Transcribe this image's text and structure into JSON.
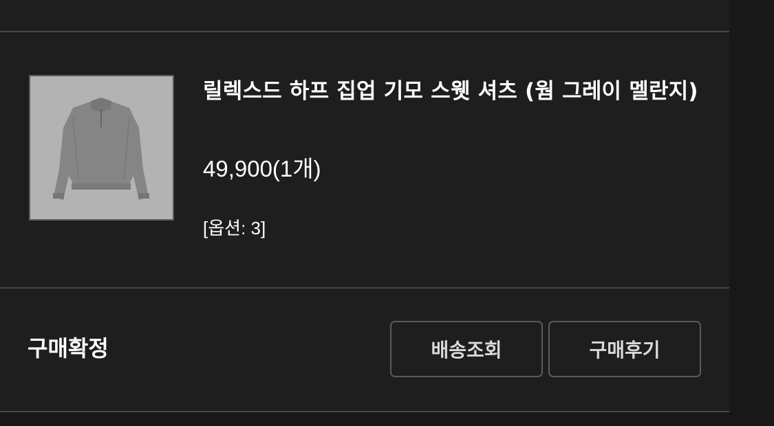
{
  "order_item": {
    "product_name": "릴렉스드 하프 집업 기모 스웻 셔츠 (웜 그레이 멜란지)",
    "price_quantity": "49,900(1개)",
    "option": "[옵션: 3]",
    "thumbnail_icon": "gray-half-zip-sweatshirt-image"
  },
  "order_status": {
    "label": "구매확정"
  },
  "actions": {
    "track_delivery_label": "배송조회",
    "write_review_label": "구매후기"
  },
  "colors": {
    "background": "#1e1e1e",
    "text": "#ffffff",
    "button_border": "#5b5b5b",
    "divider": "#474747"
  }
}
